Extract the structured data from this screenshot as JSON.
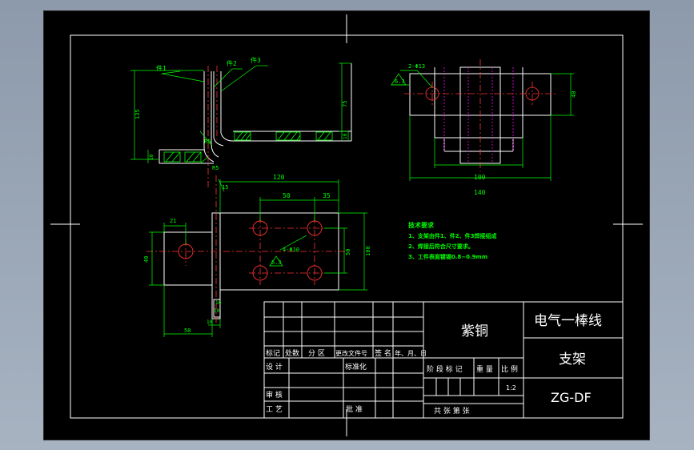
{
  "title_block": {
    "material": "紫铜",
    "part_name_line1": "电气一棒线",
    "part_name_line2": "支架",
    "drawing_number": "ZG-DF",
    "row_headers": [
      "标记",
      "处数",
      "分 区",
      "更改文件号",
      "签 名",
      "年、月、日"
    ],
    "design_label": "设 计",
    "standardize_label": "标准化",
    "review_label": "审 核",
    "process_label": "工 艺",
    "approve_label": "批 准",
    "stage_label": "阶 段 标 记",
    "weight_label": "重 量",
    "scale_label": "比 例",
    "scale_value": "1:2",
    "sheets_label": "共    张    第    张"
  },
  "notes": {
    "title": "技术要求",
    "lines": [
      "1、支架由件1、件2、件3焊接组成",
      "2、焊接后符合尺寸要求。",
      "3、工件表面镀锡0.8~0.9mm"
    ]
  },
  "side_view": {
    "labels": [
      "件1",
      "件2",
      "件3"
    ],
    "dims": [
      "135",
      "75",
      "10",
      "10",
      "R5",
      "R5"
    ]
  },
  "top_view": {
    "dims": [
      "2-Φ13",
      "6.3",
      "40",
      "100",
      "140"
    ]
  },
  "front_view": {
    "dims": [
      "120",
      "50",
      "35",
      "15",
      "4-Φ10",
      "6.3",
      "50",
      "100",
      "40",
      "21",
      "50",
      "10",
      "10",
      "10"
    ]
  }
}
